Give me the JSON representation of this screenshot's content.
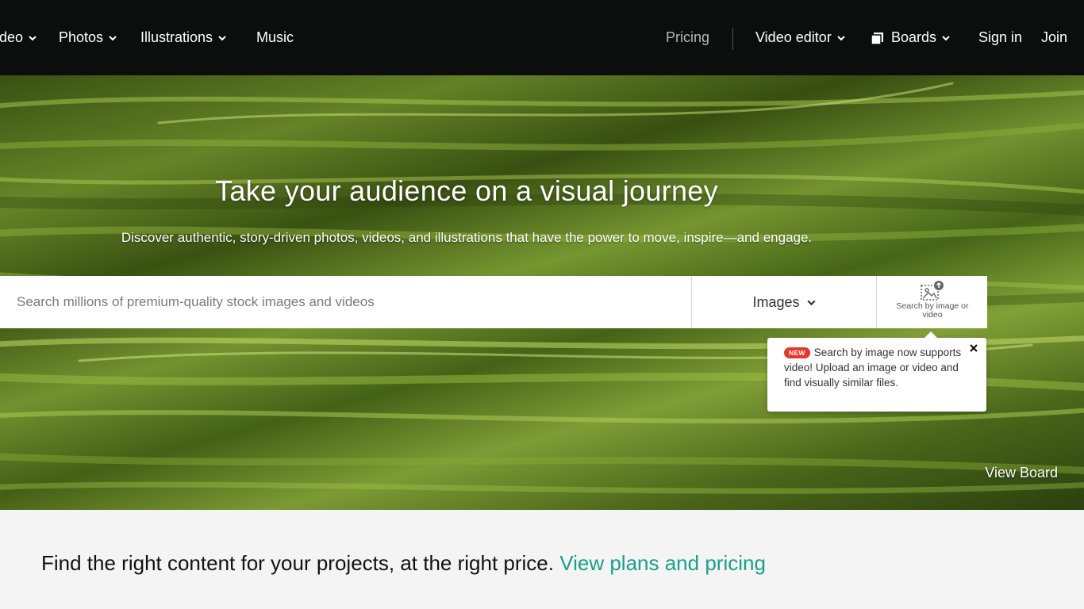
{
  "nav": {
    "left_items": [
      {
        "label": "deo",
        "has_dropdown": true
      },
      {
        "label": "Photos",
        "has_dropdown": true
      },
      {
        "label": "Illustrations",
        "has_dropdown": true
      },
      {
        "label": "Music",
        "has_dropdown": false
      }
    ],
    "pricing": "Pricing",
    "video_editor": "Video editor",
    "boards": "Boards",
    "sign_in": "Sign in",
    "join": "Join"
  },
  "hero": {
    "title": "Take your audience on a visual journey",
    "subtitle": "Discover authentic, story-driven photos, videos, and illustrations that have the power to move, inspire—and engage.",
    "view_board": "View Board"
  },
  "search": {
    "placeholder": "Search millions of premium-quality stock images and videos",
    "value": "",
    "type_selected": "Images",
    "image_search_label": "Search by image or video",
    "image_search_icon": "image-upload-icon"
  },
  "tooltip": {
    "badge": "NEW",
    "message": "Search by image now supports video! Upload an image or video and find visually similar files.",
    "close_icon": "close-icon"
  },
  "footer_band": {
    "text": "Find the right content for your projects, at the right price.",
    "link": "View plans and pricing",
    "link_color": "#19a08a"
  }
}
